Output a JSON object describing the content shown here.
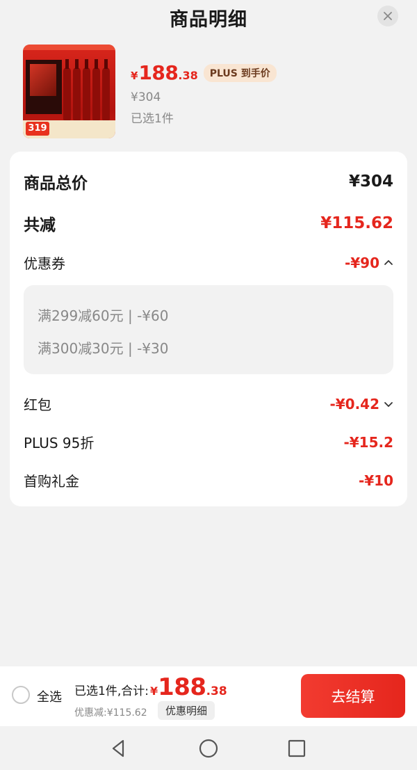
{
  "header": {
    "title": "商品明细"
  },
  "product": {
    "price_yen": "¥",
    "price_int": "188",
    "price_dec": ".38",
    "plus_badge": "PLUS 到手价",
    "original_price": "¥304",
    "selected_count": "已选1件",
    "thumb_price": "319"
  },
  "summary": {
    "total_label": "商品总价",
    "total_value": "¥304",
    "reduce_label": "共减",
    "reduce_value": "¥115.62",
    "coupon_label": "优惠券",
    "coupon_value": "-¥90",
    "coupons": [
      "满299减60元 | -¥60",
      "满300减30元 | -¥30"
    ],
    "redpacket_label": "红包",
    "redpacket_value": "-¥0.42",
    "plus_label": "PLUS 95折",
    "plus_value": "-¥15.2",
    "firstbuy_label": "首购礼金",
    "firstbuy_value": "-¥10"
  },
  "bottom": {
    "select_all": "全选",
    "sum_label": "已选1件,合计:",
    "sum_yen": "¥",
    "sum_int": "188",
    "sum_dec": ".38",
    "discount": "优惠减:¥115.62",
    "detail": "优惠明细",
    "checkout": "去结算"
  },
  "colors": {
    "accent": "#e5261d",
    "badge_bg": "#f9e5d2",
    "background": "#f2f2f2"
  }
}
